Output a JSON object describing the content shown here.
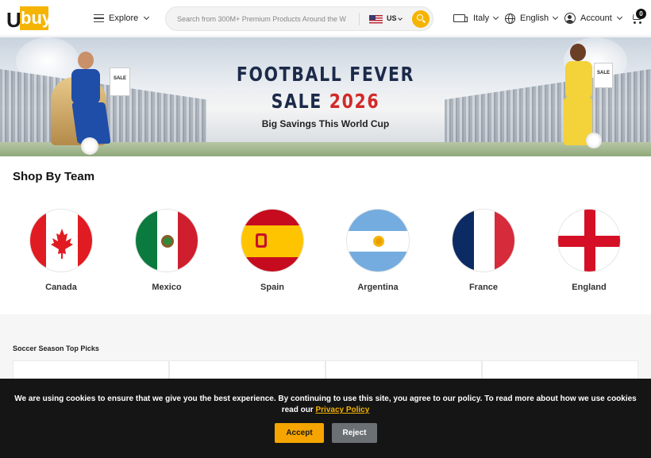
{
  "header": {
    "logo_u": "U",
    "logo_rest": "buy",
    "explore_label": "Explore",
    "search_placeholder": "Search from 300M+ Premium Products Around the W",
    "country_code": "US",
    "ship_to": "Italy",
    "language": "English",
    "account_label": "Account",
    "cart_count": "0"
  },
  "banner": {
    "line1": "FOOTBALL FEVER",
    "line2a": "SALE",
    "line2b": "2026",
    "line3": "Big Savings This World Cup",
    "bag_text": "SALE",
    "accent": "#d22a2a"
  },
  "teams": {
    "title": "Shop By Team",
    "items": [
      {
        "name": "Canada"
      },
      {
        "name": "Mexico"
      },
      {
        "name": "Spain"
      },
      {
        "name": "Argentina"
      },
      {
        "name": "France"
      },
      {
        "name": "England"
      }
    ]
  },
  "picks": {
    "title": "Soccer Season Top Picks"
  },
  "cookie": {
    "message": "We are using cookies to ensure that we give you the best experience. By continuing to use this site, you agree to our policy. To read more about how we use cookies read our",
    "link_label": "Privacy Policy",
    "accept_label": "Accept",
    "reject_label": "Reject"
  },
  "colors": {
    "brand": "#f5b400",
    "dark": "#151515"
  }
}
